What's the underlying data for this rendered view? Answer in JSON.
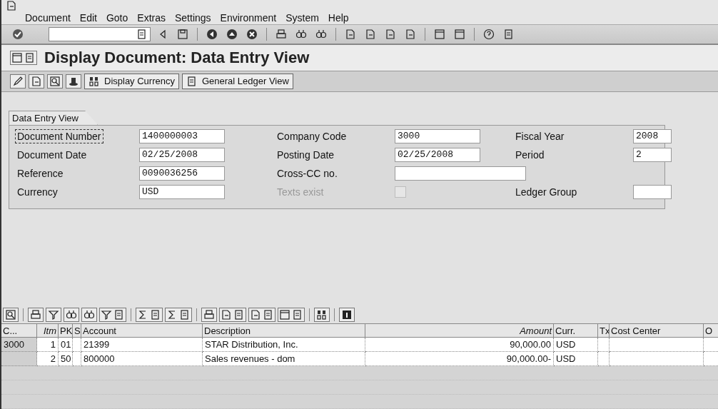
{
  "menu": [
    {
      "label": "Document"
    },
    {
      "label": "Edit"
    },
    {
      "label": "Goto"
    },
    {
      "label": "Extras"
    },
    {
      "label": "Settings"
    },
    {
      "label": "Environment"
    },
    {
      "label": "System"
    },
    {
      "label": "Help"
    }
  ],
  "title": "Display Document: Data Entry View",
  "app_toolbar": {
    "buttons": [
      {
        "label": "Display Currency"
      },
      {
        "label": "General Ledger View"
      }
    ]
  },
  "header_group": {
    "title": "Data Entry View",
    "rows": [
      [
        {
          "kind": "field",
          "label": "Document Number",
          "value": "1400000003",
          "focused": true
        },
        {
          "kind": "field",
          "label": "Company Code",
          "value": "3000",
          "focused": false
        },
        {
          "kind": "field",
          "label": "Fiscal Year",
          "value": "2008",
          "focused": false
        }
      ],
      [
        {
          "kind": "field",
          "label": "Document Date",
          "value": "02/25/2008",
          "focused": false
        },
        {
          "kind": "field",
          "label": "Posting Date",
          "value": "02/25/2008",
          "focused": false
        },
        {
          "kind": "field",
          "label": "Period",
          "value": "2",
          "focused": false
        }
      ],
      [
        {
          "kind": "field",
          "label": "Reference",
          "value": "0090036256",
          "focused": false
        },
        {
          "kind": "wide_field",
          "label": "Cross-CC no.",
          "focused": false
        }
      ],
      [
        {
          "kind": "field",
          "label": "Currency",
          "value": "USD",
          "focused": false
        },
        {
          "kind": "checkbox",
          "label": "Texts exist",
          "checked": false,
          "disabled": true
        },
        {
          "kind": "field",
          "label": "Ledger Group",
          "focused": false
        }
      ]
    ]
  },
  "table": {
    "columns": [
      "C...",
      "Itm",
      "PK",
      "S",
      "Account",
      "Description",
      "Amount",
      "Curr.",
      "Tx",
      "Cost Center",
      "O"
    ],
    "rows": [
      [
        "3000",
        "1",
        "01",
        null,
        "21399",
        "STAR Distribution, Inc.",
        "90,000.00",
        "USD",
        null,
        null,
        null
      ],
      [
        null,
        "2",
        "50",
        null,
        "800000",
        "Sales revenues - dom",
        "90,000.00-",
        "USD",
        null,
        null,
        null
      ]
    ]
  }
}
